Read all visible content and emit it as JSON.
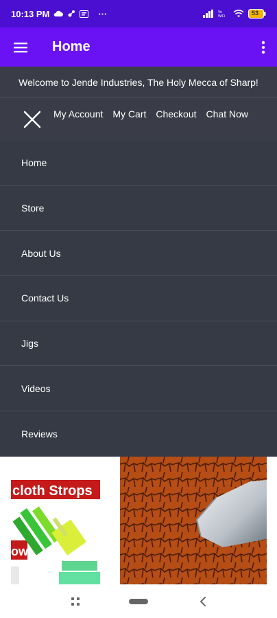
{
  "status_bar": {
    "time": "10:13 PM",
    "dots": "···",
    "battery": "53"
  },
  "app_bar": {
    "title": "Home"
  },
  "welcome": {
    "text": "Welcome to Jende Industries, The Holy Mecca of Sharp!"
  },
  "top_nav": {
    "links": [
      "My Account",
      "My Cart",
      "Checkout",
      "Chat Now"
    ]
  },
  "drawer": {
    "items": [
      "Home",
      "Store",
      "About Us",
      "Contact Us",
      "Jigs",
      "Videos",
      "Reviews"
    ]
  },
  "content": {
    "promo_left_label": "cloth Strops",
    "promo_left_badge": "ow"
  },
  "colors": {
    "status_bar": "#4a0fd0",
    "app_bar": "#6a12f3",
    "drawer": "#363a44",
    "banner": "#3a3d47"
  }
}
